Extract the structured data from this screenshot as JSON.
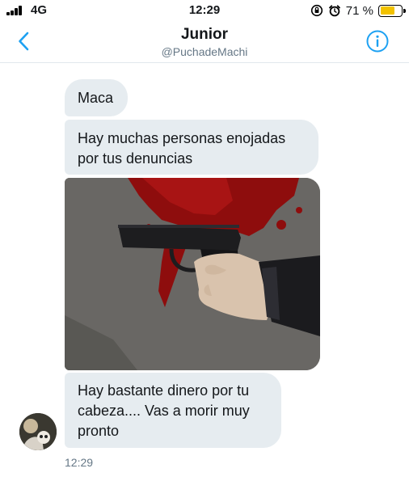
{
  "status_bar": {
    "network": "4G",
    "time": "12:29",
    "battery_percent_label": "71 %",
    "battery_level": 0.71,
    "icons": [
      "signal-bars-icon",
      "orientation-lock-icon",
      "alarm-icon",
      "battery-icon"
    ]
  },
  "header": {
    "title": "Junior",
    "handle": "@PuchadeMachi",
    "back_icon": "chevron-left-icon",
    "info_icon": "info-circle-icon",
    "accent": "#1da1f2"
  },
  "conversation": {
    "messages": [
      {
        "type": "text",
        "text": "Maca"
      },
      {
        "type": "text",
        "text": "Hay muchas personas enojadas por tus denuncias"
      },
      {
        "type": "image",
        "description": ""
      },
      {
        "type": "text",
        "text": "Hay bastante dinero por tu cabeza.... Vas a morir muy pronto"
      }
    ],
    "timestamp": "12:29",
    "bubble_color": "#e6ecf0"
  }
}
